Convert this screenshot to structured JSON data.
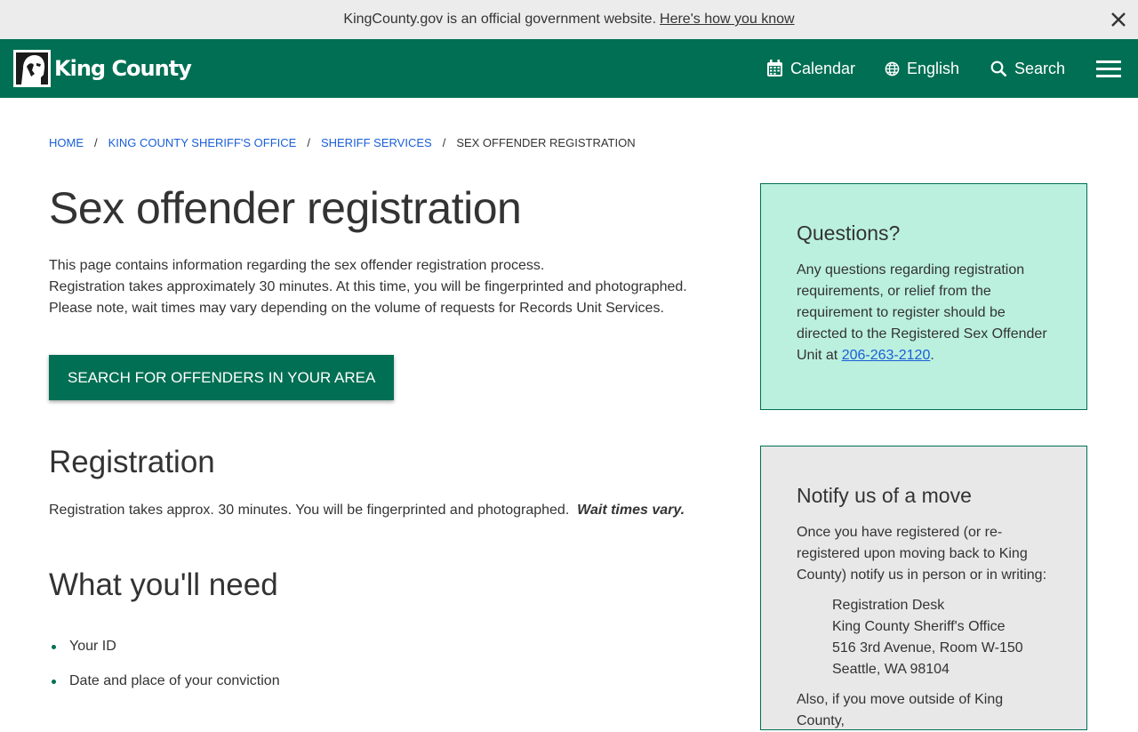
{
  "banner": {
    "text": "KingCounty.gov is an official government website.",
    "link": "Here's how you know"
  },
  "header": {
    "logo_text": "King County",
    "nav": {
      "calendar": "Calendar",
      "language": "English",
      "search": "Search"
    }
  },
  "breadcrumb": {
    "items": [
      "HOME",
      "KING COUNTY SHERIFF'S OFFICE",
      "SHERIFF SERVICES"
    ],
    "current": "SEX OFFENDER REGISTRATION",
    "separator": "/"
  },
  "main": {
    "title": "Sex offender registration",
    "intro_line1": "This page contains information regarding the sex offender registration process.",
    "intro_line2": "Registration takes approximately 30 minutes. At this time, you will be fingerprinted and photographed. Please note, wait times may vary depending on the volume of requests for Records Unit Services.",
    "cta_label": "SEARCH FOR OFFENDERS IN YOUR AREA",
    "registration_heading": "Registration",
    "registration_text": "Registration takes approx. 30 minutes.  You will be fingerprinted and photographed.",
    "registration_emphasis": "Wait times vary.",
    "need_heading": "What you'll need",
    "need_items": [
      "Your ID",
      "Date and place of your conviction"
    ]
  },
  "sidebar": {
    "questions": {
      "title": "Questions?",
      "text": "Any questions regarding registration requirements, or relief from the requirement to register should be directed to the Registered Sex Offender Unit at",
      "phone": "206-263-2120",
      "trail": "."
    },
    "move": {
      "title": "Notify us of a move",
      "text": "Once you have registered (or re-registered upon moving back to King County) notify us in person or in writing:",
      "address": [
        "Registration Desk",
        "King County Sheriff's Office",
        "516 3rd Avenue, Room W-150",
        "Seattle, WA 98104"
      ],
      "tail": "Also, if you move outside of King County,"
    }
  },
  "colors": {
    "brand_green": "#006f53",
    "questions_bg": "#bbf0df",
    "move_bg": "#e8e8e8",
    "banner_bg": "#ececec",
    "link": "#1a5ed8"
  }
}
